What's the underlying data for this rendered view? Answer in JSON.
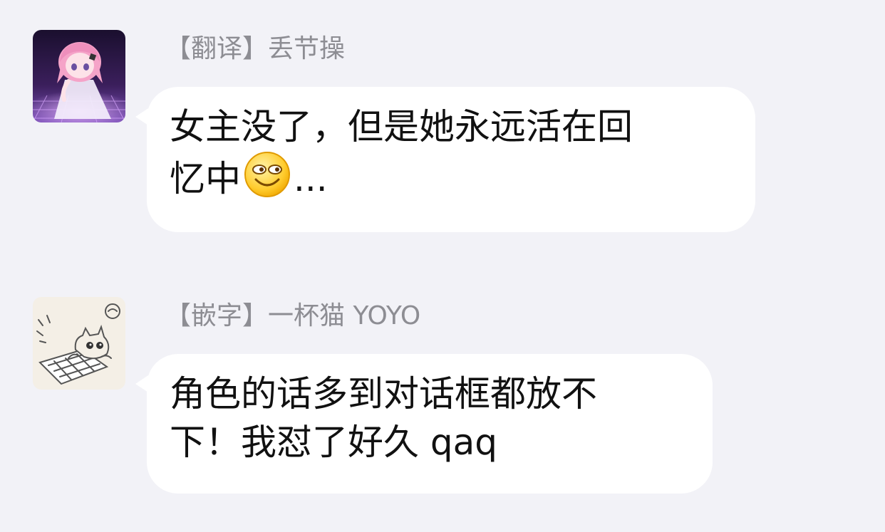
{
  "messages": [
    {
      "sender": "【翻译】丢节操",
      "line1": "女主没了，但是她永远活在回",
      "line2_text": "忆中",
      "line2_suffix": "...",
      "emoji": "smiling-face-emoji"
    },
    {
      "sender": "【嵌字】一杯猫 YOYO",
      "line1": "角色的话多到对话框都放不",
      "line2_text": "下！我怼了好久 qaq"
    }
  ],
  "colors": {
    "background": "#f2f2f7",
    "bubble": "#ffffff",
    "sender_text": "#8d8d93",
    "message_text": "#111111"
  },
  "icons": [
    "anime-girl-avatar",
    "cat-keyboard-avatar",
    "smiling-face-emoji"
  ]
}
